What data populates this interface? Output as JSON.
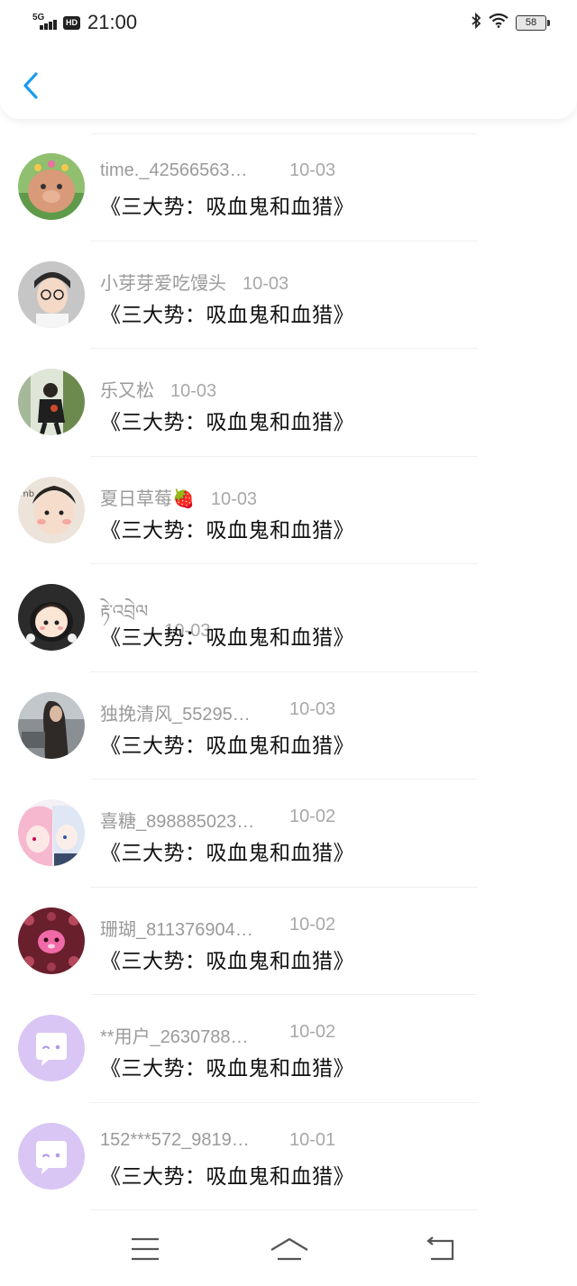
{
  "status_bar": {
    "network": "5G",
    "hd_badge": "HD",
    "time": "21:00",
    "bluetooth_icon": "bluetooth-icon",
    "wifi_icon": "wifi-icon",
    "battery": "58"
  },
  "header": {
    "back_icon": "chevron-left-icon",
    "accent_color": "#1a9bf0"
  },
  "items": [
    {
      "name": "time._42566563…",
      "date": "10-03",
      "title": "《三大势：吸血鬼和血猎》"
    },
    {
      "name": "小芽芽爱吃馒头",
      "date": "10-03",
      "title": "《三大势：吸血鬼和血猎》"
    },
    {
      "name": "乐又松",
      "date": "10-03",
      "title": "《三大势：吸血鬼和血猎》"
    },
    {
      "name": "夏日草莓🍓",
      "date": "10-03",
      "title": "《三大势：吸血鬼和血猎》"
    },
    {
      "name": "རྟེ་འབྲེལ",
      "date": "10-03",
      "title": "《三大势：吸血鬼和血猎》"
    },
    {
      "name": "独挽清风_55295…",
      "date": "10-03",
      "title": "《三大势：吸血鬼和血猎》"
    },
    {
      "name": "喜糖_898885023…",
      "date": "10-02",
      "title": "《三大势：吸血鬼和血猎》"
    },
    {
      "name": "珊瑚_811376904…",
      "date": "10-02",
      "title": "《三大势：吸血鬼和血猎》"
    },
    {
      "name": "**用户_2630788…",
      "date": "10-02",
      "title": "《三大势：吸血鬼和血猎》"
    },
    {
      "name": "152***572_9819…",
      "date": "10-01",
      "title": "《三大势：吸血鬼和血猎》"
    }
  ],
  "nav_bar": {
    "menu_icon": "menu-icon",
    "home_icon": "home-icon",
    "back_icon": "back-icon"
  }
}
